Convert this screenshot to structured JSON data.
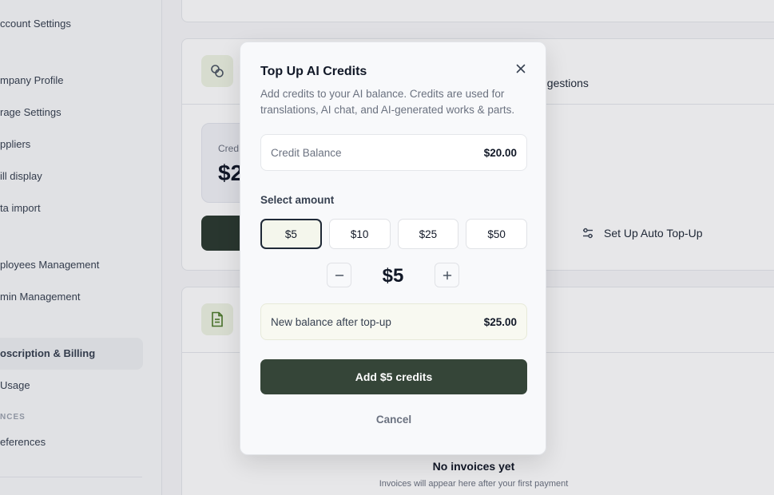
{
  "sidebar": {
    "items": [
      {
        "label": "ccount Settings"
      },
      {
        "label": "mpany Profile"
      },
      {
        "label": "rage Settings"
      },
      {
        "label": "ppliers"
      },
      {
        "label": "ill display"
      },
      {
        "label": "ta import"
      },
      {
        "label": "ployees Management"
      },
      {
        "label": "min Management"
      },
      {
        "label": "oscription & Billing"
      },
      {
        "label": "Usage"
      },
      {
        "label": "eferences"
      }
    ],
    "section_label": "NCES"
  },
  "background": {
    "credits_card_title_fragment": "ggestions",
    "balance_label_fragment": "Cred",
    "balance_value_fragment": "$2",
    "auto_topup_label": "Set Up Auto Top-Up",
    "empty_title": "No invoices yet",
    "empty_subtitle": "Invoices will appear here after your first payment"
  },
  "modal": {
    "title": "Top Up AI Credits",
    "description": "Add credits to your AI balance. Credits are used for translations, AI chat, and AI-generated works & parts.",
    "current_balance_label": "Credit Balance",
    "current_balance_value": "$20.00",
    "select_label": "Select amount",
    "amounts": [
      {
        "label": "$5",
        "selected": true
      },
      {
        "label": "$10",
        "selected": false
      },
      {
        "label": "$25",
        "selected": false
      },
      {
        "label": "$50",
        "selected": false
      }
    ],
    "stepper_value": "$5",
    "new_balance_label": "New balance after top-up",
    "new_balance_value": "$25.00",
    "primary_button": "Add $5 credits",
    "cancel_button": "Cancel"
  },
  "colors": {
    "primary": "#354538",
    "selected_bg": "#f4f6ec",
    "icon_tile": "#eef3e3"
  },
  "icons": {
    "close": "close-icon",
    "minus": "minus-icon",
    "plus": "plus-icon",
    "credits": "coins-icon",
    "invoices": "document-icon",
    "auto_topup": "sliders-icon"
  }
}
